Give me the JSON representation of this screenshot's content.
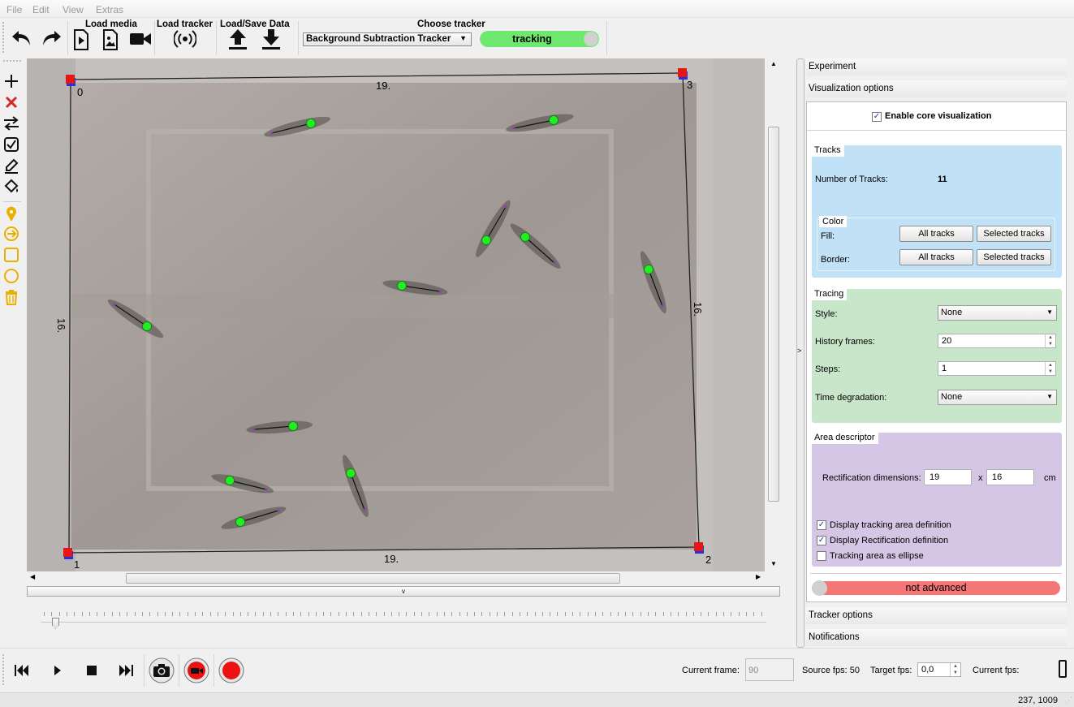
{
  "menu": [
    "File",
    "Edit",
    "View",
    "Extras"
  ],
  "toolbar": {
    "load_media": "Load media",
    "load_tracker": "Load tracker",
    "load_save": "Load/Save Data",
    "choose_tracker": "Choose tracker",
    "tracker_value": "Background Subtraction Tracker",
    "tracking": "tracking"
  },
  "video": {
    "corners": [
      "0",
      "1",
      "2",
      "3"
    ],
    "edge_top": "19.",
    "edge_bottom": "19.",
    "edge_left": "16.",
    "edge_right": "16."
  },
  "panel": {
    "experiment": "Experiment",
    "visualization_options": "Visualization options",
    "enable_core": "Enable core visualization",
    "tracks": {
      "title": "Tracks",
      "num_label": "Number of Tracks:",
      "num_value": "11",
      "color_title": "Color",
      "fill_label": "Fill:",
      "border_label": "Border:",
      "all_tracks": "All tracks",
      "selected_tracks": "Selected tracks"
    },
    "tracing": {
      "title": "Tracing",
      "style_label": "Style:",
      "style_value": "None",
      "history_label": "History frames:",
      "history_value": "20",
      "steps_label": "Steps:",
      "steps_value": "1",
      "time_label": "Time degradation:",
      "time_value": "None"
    },
    "area": {
      "title": "Area descriptor",
      "rect_label": "Rectification dimensions:",
      "rect_w": "19",
      "rect_x": "x",
      "rect_h": "16",
      "rect_unit": "cm",
      "display_tracking": "Display tracking area definition",
      "display_rect": "Display Rectification definition",
      "ellipse": "Tracking area as ellipse"
    },
    "advanced": "not advanced",
    "tracker_options": "Tracker options",
    "notifications": "Notifications"
  },
  "bottom": {
    "current_frame_label": "Current frame:",
    "current_frame_value": "90",
    "source_fps": "Source fps: 50",
    "target_fps_label": "Target fps:",
    "target_fps_value": "0,0",
    "current_fps_label": "Current fps:"
  },
  "status": "237, 1009",
  "colors": {
    "tracking_green": "#6ee86e",
    "not_advanced_red": "#f47676",
    "tracks_bg": "#c1e1f6",
    "tracing_bg": "#c8e6c9",
    "area_bg": "#d5c6e6",
    "tool_yellow": "#e8b000",
    "track_dot": "#22ee22"
  }
}
